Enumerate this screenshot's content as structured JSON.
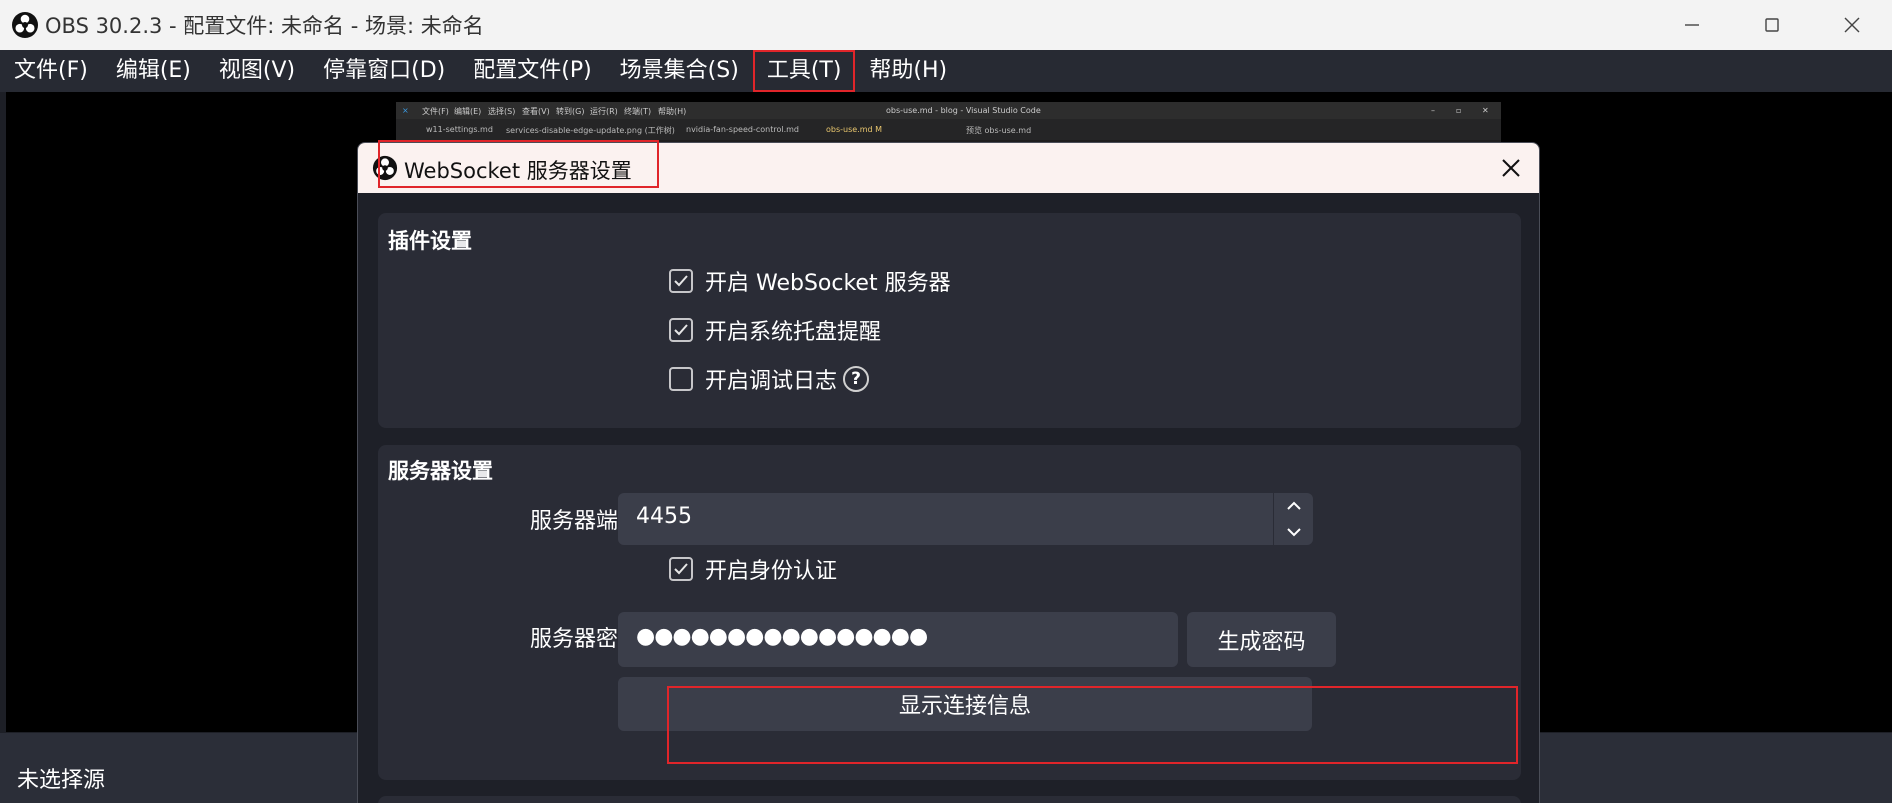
{
  "window": {
    "title": "OBS 30.2.3 - 配置文件: 未命名 - 场景: 未命名"
  },
  "menu": [
    {
      "label": "文件(F)",
      "name": "menu-file"
    },
    {
      "label": "编辑(E)",
      "name": "menu-edit"
    },
    {
      "label": "视图(V)",
      "name": "menu-view"
    },
    {
      "label": "停靠窗口(D)",
      "name": "menu-docks"
    },
    {
      "label": "配置文件(P)",
      "name": "menu-profile"
    },
    {
      "label": "场景集合(S)",
      "name": "menu-scene-collection"
    },
    {
      "label": "工具(T)",
      "name": "menu-tools"
    },
    {
      "label": "帮助(H)",
      "name": "menu-help"
    }
  ],
  "preview": {
    "no_source_label": "未选择源",
    "vscode_title": "obs-use.md - blog - Visual Studio Code",
    "vscode_menu": [
      "文件(F)",
      "编辑(E)",
      "选择(S)",
      "查看(V)",
      "转到(G)",
      "运行(R)",
      "终端(T)",
      "帮助(H)"
    ],
    "vscode_tabs": [
      "w11-settings.md",
      "services-disable-edge-update.png (工作树)",
      "nvidia-fan-speed-control.md",
      "obs-use.md M",
      "预览 obs-use.md"
    ]
  },
  "dialog": {
    "title": "WebSocket 服务器设置",
    "plugin_group": {
      "title": "插件设置",
      "enable_server": {
        "label": "开启 WebSocket 服务器",
        "checked": true
      },
      "enable_tray": {
        "label": "开启系统托盘提醒",
        "checked": true
      },
      "enable_debug": {
        "label": "开启调试日志",
        "checked": false
      }
    },
    "server_group": {
      "title": "服务器设置",
      "port_label": "服务器端口",
      "port_value": "4455",
      "auth": {
        "label": "开启身份认证",
        "checked": true
      },
      "password_label": "服务器密码",
      "password_value": "●●●●●●●●●●●●●●●●",
      "generate_button": "生成密码",
      "show_connect_info_button": "显示连接信息"
    }
  },
  "colors": {
    "highlight_red": "#e0252a",
    "dialog_bg": "#1e2028",
    "group_bg": "#2a2c36",
    "input_bg": "#3b3e4a"
  }
}
